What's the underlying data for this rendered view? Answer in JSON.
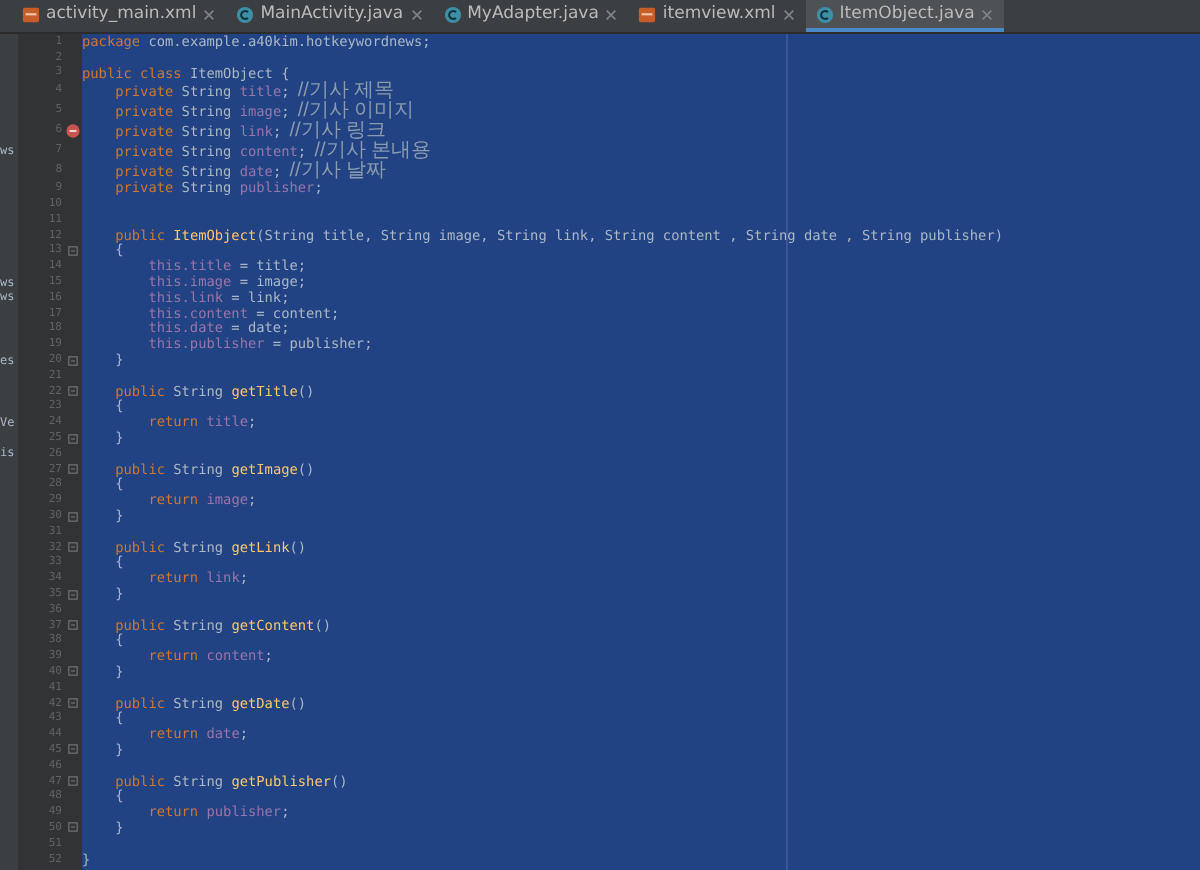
{
  "tabs": [
    {
      "label": "activity_main.xml",
      "kind": "xml",
      "selected": false
    },
    {
      "label": "MainActivity.java",
      "kind": "java",
      "selected": false
    },
    {
      "label": "MyAdapter.java",
      "kind": "java",
      "selected": false
    },
    {
      "label": "itemview.xml",
      "kind": "xml",
      "selected": false
    },
    {
      "label": "ItemObject.java",
      "kind": "java",
      "selected": true
    }
  ],
  "lines": [
    {
      "number": "1",
      "tokens": [
        {
          "kind": "kw",
          "text": "package"
        },
        {
          "kind": "plain",
          "text": " com.example.a40kim.hotkeywordnews;"
        }
      ]
    },
    {
      "number": "2"
    },
    {
      "number": "3",
      "tokens": [
        {
          "kind": "kw",
          "text": "public class"
        },
        {
          "kind": "plain",
          "text": " ItemObject {"
        }
      ]
    },
    {
      "number": "4",
      "tokens": [
        {
          "kind": "kw",
          "text": "    private"
        },
        {
          "kind": "plain",
          "text": " String "
        },
        {
          "kind": "field",
          "text": "title"
        },
        {
          "kind": "plain",
          "text": "; "
        },
        {
          "kind": "comment",
          "text": "//기사 제목"
        }
      ]
    },
    {
      "number": "5",
      "tokens": [
        {
          "kind": "kw",
          "text": "    private"
        },
        {
          "kind": "plain",
          "text": " String "
        },
        {
          "kind": "field",
          "text": "image"
        },
        {
          "kind": "plain",
          "text": "; "
        },
        {
          "kind": "comment",
          "text": "//기사 이미지"
        }
      ]
    },
    {
      "number": "6",
      "breakpoint": true,
      "tokens": [
        {
          "kind": "kw",
          "text": "    private"
        },
        {
          "kind": "plain",
          "text": " String "
        },
        {
          "kind": "field",
          "text": "link"
        },
        {
          "kind": "plain",
          "text": "; "
        },
        {
          "kind": "comment",
          "text": "//기사 링크"
        }
      ]
    },
    {
      "number": "7",
      "side": "ws",
      "tokens": [
        {
          "kind": "kw",
          "text": "    private"
        },
        {
          "kind": "plain",
          "text": " String "
        },
        {
          "kind": "field",
          "text": "content"
        },
        {
          "kind": "plain",
          "text": "; "
        },
        {
          "kind": "comment",
          "text": "//기사 본내용"
        }
      ]
    },
    {
      "number": "8",
      "tokens": [
        {
          "kind": "kw",
          "text": "    private"
        },
        {
          "kind": "plain",
          "text": " String "
        },
        {
          "kind": "field",
          "text": "date"
        },
        {
          "kind": "plain",
          "text": "; "
        },
        {
          "kind": "comment",
          "text": "//기사 날짜"
        }
      ]
    },
    {
      "number": "9",
      "tokens": [
        {
          "kind": "kw",
          "text": "    private"
        },
        {
          "kind": "plain",
          "text": " String "
        },
        {
          "kind": "field",
          "text": "publisher"
        },
        {
          "kind": "plain",
          "text": ";"
        }
      ]
    },
    {
      "number": "10"
    },
    {
      "number": "11"
    },
    {
      "number": "12",
      "tokens": [
        {
          "kind": "kw",
          "text": "    public "
        },
        {
          "kind": "method",
          "text": "ItemObject"
        },
        {
          "kind": "plain",
          "text": "(String title, String image, String link, String content , String date , String publisher)"
        }
      ]
    },
    {
      "number": "13",
      "fold": true,
      "tokens": [
        {
          "kind": "plain",
          "text": "    {"
        }
      ]
    },
    {
      "number": "14",
      "tokens": [
        {
          "kind": "field",
          "text": "        this.title"
        },
        {
          "kind": "plain",
          "text": " = title;"
        }
      ]
    },
    {
      "number": "15",
      "side": "ws",
      "tokens": [
        {
          "kind": "field",
          "text": "        this.image"
        },
        {
          "kind": "plain",
          "text": " = image;"
        }
      ]
    },
    {
      "number": "16",
      "side": "ws",
      "tokens": [
        {
          "kind": "field",
          "text": "        this.link"
        },
        {
          "kind": "plain",
          "text": " = link;"
        }
      ]
    },
    {
      "number": "17",
      "tokens": [
        {
          "kind": "field",
          "text": "        this.content"
        },
        {
          "kind": "plain",
          "text": " = content;"
        }
      ]
    },
    {
      "number": "18",
      "tokens": [
        {
          "kind": "field",
          "text": "        this.date"
        },
        {
          "kind": "plain",
          "text": " = date;"
        }
      ]
    },
    {
      "number": "19",
      "tokens": [
        {
          "kind": "field",
          "text": "        this.publisher"
        },
        {
          "kind": "plain",
          "text": " = publisher;"
        }
      ]
    },
    {
      "number": "20",
      "fold": true,
      "side": "es",
      "tokens": [
        {
          "kind": "plain",
          "text": "    }"
        }
      ]
    },
    {
      "number": "21"
    },
    {
      "number": "22",
      "fold": true,
      "tokens": [
        {
          "kind": "kw",
          "text": "    public"
        },
        {
          "kind": "plain",
          "text": " String "
        },
        {
          "kind": "method",
          "text": "getTitle"
        },
        {
          "kind": "plain",
          "text": "()"
        }
      ]
    },
    {
      "number": "23",
      "tokens": [
        {
          "kind": "plain",
          "text": "    {"
        }
      ]
    },
    {
      "number": "24",
      "side": "Ve",
      "tokens": [
        {
          "kind": "kw",
          "text": "        return"
        },
        {
          "kind": "field",
          "text": " title"
        },
        {
          "kind": "plain",
          "text": ";"
        }
      ]
    },
    {
      "number": "25",
      "fold": true,
      "tokens": [
        {
          "kind": "plain",
          "text": "    }"
        }
      ]
    },
    {
      "number": "26",
      "side": "is"
    },
    {
      "number": "27",
      "fold": true,
      "tokens": [
        {
          "kind": "kw",
          "text": "    public"
        },
        {
          "kind": "plain",
          "text": " String "
        },
        {
          "kind": "method",
          "text": "getImage"
        },
        {
          "kind": "plain",
          "text": "()"
        }
      ]
    },
    {
      "number": "28",
      "tokens": [
        {
          "kind": "plain",
          "text": "    {"
        }
      ]
    },
    {
      "number": "29",
      "tokens": [
        {
          "kind": "kw",
          "text": "        return"
        },
        {
          "kind": "field",
          "text": " image"
        },
        {
          "kind": "plain",
          "text": ";"
        }
      ]
    },
    {
      "number": "30",
      "fold": true,
      "tokens": [
        {
          "kind": "plain",
          "text": "    }"
        }
      ]
    },
    {
      "number": "31"
    },
    {
      "number": "32",
      "fold": true,
      "tokens": [
        {
          "kind": "kw",
          "text": "    public"
        },
        {
          "kind": "plain",
          "text": " String "
        },
        {
          "kind": "method",
          "text": "getLink"
        },
        {
          "kind": "plain",
          "text": "()"
        }
      ]
    },
    {
      "number": "33",
      "tokens": [
        {
          "kind": "plain",
          "text": "    {"
        }
      ]
    },
    {
      "number": "34",
      "tokens": [
        {
          "kind": "kw",
          "text": "        return"
        },
        {
          "kind": "field",
          "text": " link"
        },
        {
          "kind": "plain",
          "text": ";"
        }
      ]
    },
    {
      "number": "35",
      "fold": true,
      "tokens": [
        {
          "kind": "plain",
          "text": "    }"
        }
      ]
    },
    {
      "number": "36"
    },
    {
      "number": "37",
      "fold": true,
      "tokens": [
        {
          "kind": "kw",
          "text": "    public"
        },
        {
          "kind": "plain",
          "text": " String "
        },
        {
          "kind": "method",
          "text": "getContent"
        },
        {
          "kind": "plain",
          "text": "()"
        }
      ]
    },
    {
      "number": "38",
      "tokens": [
        {
          "kind": "plain",
          "text": "    {"
        }
      ]
    },
    {
      "number": "39",
      "tokens": [
        {
          "kind": "kw",
          "text": "        return"
        },
        {
          "kind": "field",
          "text": " content"
        },
        {
          "kind": "plain",
          "text": ";"
        }
      ]
    },
    {
      "number": "40",
      "fold": true,
      "tokens": [
        {
          "kind": "plain",
          "text": "    }"
        }
      ]
    },
    {
      "number": "41"
    },
    {
      "number": "42",
      "fold": true,
      "tokens": [
        {
          "kind": "kw",
          "text": "    public"
        },
        {
          "kind": "plain",
          "text": " String "
        },
        {
          "kind": "method",
          "text": "getDate"
        },
        {
          "kind": "plain",
          "text": "()"
        }
      ]
    },
    {
      "number": "43",
      "tokens": [
        {
          "kind": "plain",
          "text": "    {"
        }
      ]
    },
    {
      "number": "44",
      "tokens": [
        {
          "kind": "kw",
          "text": "        return"
        },
        {
          "kind": "field",
          "text": " date"
        },
        {
          "kind": "plain",
          "text": ";"
        }
      ]
    },
    {
      "number": "45",
      "fold": true,
      "tokens": [
        {
          "kind": "plain",
          "text": "    }"
        }
      ]
    },
    {
      "number": "46"
    },
    {
      "number": "47",
      "fold": true,
      "tokens": [
        {
          "kind": "kw",
          "text": "    public"
        },
        {
          "kind": "plain",
          "text": " String "
        },
        {
          "kind": "method",
          "text": "getPublisher"
        },
        {
          "kind": "plain",
          "text": "()"
        }
      ]
    },
    {
      "number": "48",
      "tokens": [
        {
          "kind": "plain",
          "text": "    {"
        }
      ]
    },
    {
      "number": "49",
      "tokens": [
        {
          "kind": "kw",
          "text": "        return"
        },
        {
          "kind": "field",
          "text": " publisher"
        },
        {
          "kind": "plain",
          "text": ";"
        }
      ]
    },
    {
      "number": "50",
      "fold": true,
      "tokens": [
        {
          "kind": "plain",
          "text": "    }"
        }
      ]
    },
    {
      "number": "51"
    },
    {
      "number": "52",
      "tokens": [
        {
          "kind": "plain",
          "text": "}"
        }
      ]
    }
  ]
}
